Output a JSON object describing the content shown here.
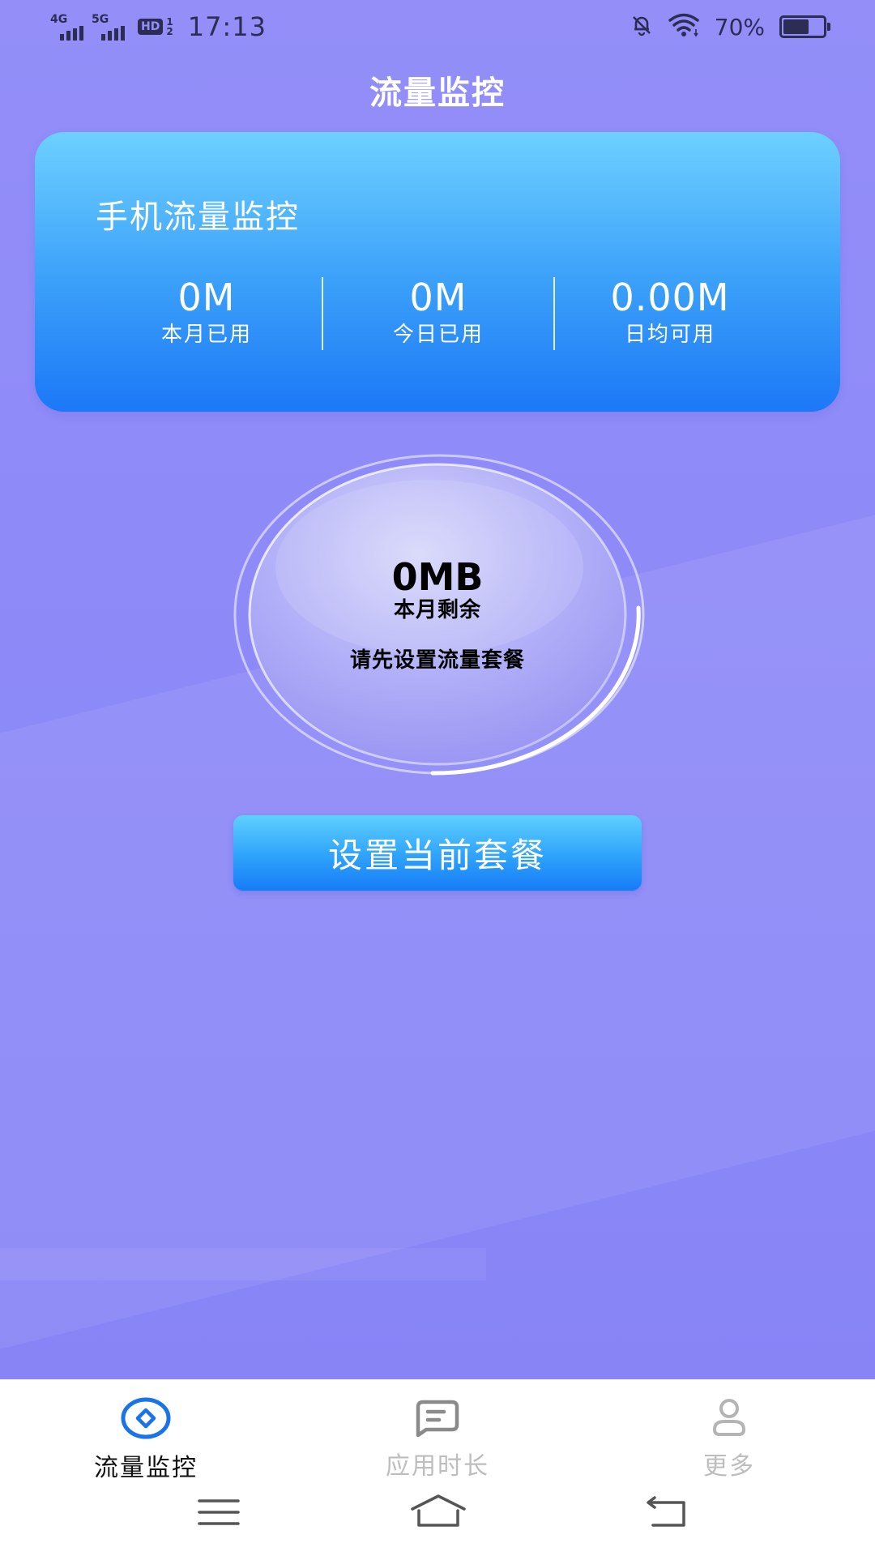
{
  "status_bar": {
    "net1": "4G",
    "net2": "5G",
    "hd_badge": "HD",
    "hd_sub": "1\n2",
    "time": "17:13",
    "battery_percent": "70%",
    "battery_level": 0.7,
    "icons": [
      "signal-4g-icon",
      "signal-5g-icon",
      "hd-voice-icon",
      "mute-bell-icon",
      "wifi-icon",
      "battery-icon"
    ]
  },
  "header": {
    "title": "流量监控"
  },
  "stats_card": {
    "title": "手机流量监控",
    "items": [
      {
        "value": "0M",
        "label": "本月已用"
      },
      {
        "value": "0M",
        "label": "今日已用"
      },
      {
        "value": "0.00M",
        "label": "日均可用"
      }
    ]
  },
  "dial": {
    "remaining_value": "0MB",
    "remaining_label": "本月剩余",
    "hint": "请先设置流量套餐"
  },
  "set_plan_button": {
    "label": "设置当前套餐"
  },
  "bottom_nav": {
    "tabs": [
      {
        "label": "流量监控",
        "icon": "traffic-monitor-icon",
        "active": true
      },
      {
        "label": "应用时长",
        "icon": "message-square-icon",
        "active": false
      },
      {
        "label": "更多",
        "icon": "person-icon",
        "active": false
      }
    ],
    "active_color": "#1a73e8",
    "inactive_color": "#bdbdbd"
  },
  "system_nav": {
    "icons": [
      "menu-icon",
      "home-icon",
      "back-icon"
    ]
  },
  "colors": {
    "background": "#8b88f8",
    "card_top": "#6dd0ff",
    "card_bottom": "#1c78f7",
    "text_dark": "#2a2b4d"
  }
}
